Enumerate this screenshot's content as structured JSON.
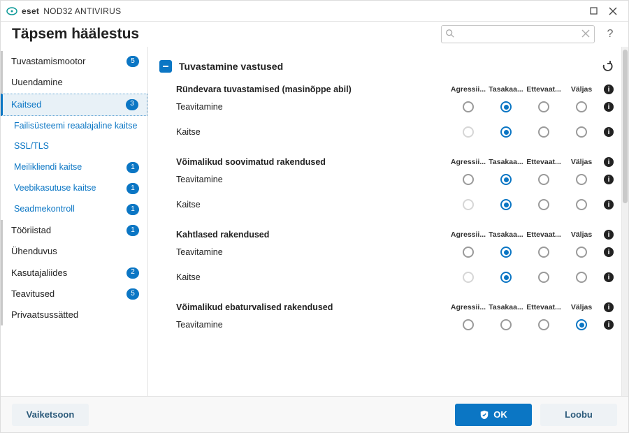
{
  "titlebar": {
    "brand_bold": "eset",
    "brand_rest": "NOD32 ANTIVIRUS"
  },
  "header": {
    "title": "Täpsem häälestus",
    "search_placeholder": "",
    "help": "?"
  },
  "sidebar": {
    "items": [
      {
        "label": "Tuvastamismootor",
        "badge": "5"
      },
      {
        "label": "Uuendamine"
      },
      {
        "label": "Kaitsed",
        "badge": "3",
        "selected": true
      },
      {
        "label": "Failisüsteemi reaalajaline kaitse"
      },
      {
        "label": "SSL/TLS"
      },
      {
        "label": "Meilikliendi kaitse",
        "badge": "1"
      },
      {
        "label": "Veebikasutuse kaitse",
        "badge": "1"
      },
      {
        "label": "Seadmekontroll",
        "badge": "1"
      },
      {
        "label": "Tööriistad",
        "badge": "1"
      },
      {
        "label": "Ühenduvus"
      },
      {
        "label": "Kasutajaliides",
        "badge": "2"
      },
      {
        "label": "Teavitused",
        "badge": "5"
      },
      {
        "label": "Privaatsussätted"
      }
    ]
  },
  "section": {
    "title": "Tuvastamine vastused",
    "columns": [
      "Agressii...",
      "Tasakaa...",
      "Ettevaat...",
      "Väljas"
    ],
    "groups": [
      {
        "title": "Ründevara tuvastamised (masinõppe abil)",
        "rows": [
          {
            "label": "Teavitamine",
            "selected": 1,
            "disabled": []
          },
          {
            "label": "Kaitse",
            "selected": 1,
            "disabled": [
              0
            ]
          }
        ]
      },
      {
        "title": "Võimalikud soovimatud rakendused",
        "rows": [
          {
            "label": "Teavitamine",
            "selected": 1,
            "disabled": []
          },
          {
            "label": "Kaitse",
            "selected": 1,
            "disabled": [
              0
            ]
          }
        ]
      },
      {
        "title": "Kahtlased rakendused",
        "rows": [
          {
            "label": "Teavitamine",
            "selected": 1,
            "disabled": []
          },
          {
            "label": "Kaitse",
            "selected": 1,
            "disabled": [
              0
            ]
          }
        ]
      },
      {
        "title": "Võimalikud ebaturvalised rakendused",
        "rows": [
          {
            "label": "Teavitamine",
            "selected": 3,
            "disabled": []
          }
        ]
      }
    ]
  },
  "footer": {
    "defaults": "Vaiketsoon",
    "ok": "OK",
    "cancel": "Loobu"
  },
  "colors": {
    "accent": "#0b76c4",
    "teal": "#0f9a99"
  }
}
